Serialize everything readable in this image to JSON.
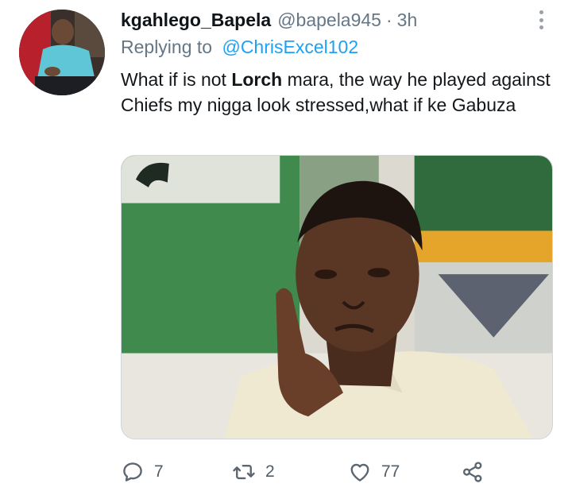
{
  "author": {
    "display_name": "kgahlego_Bapela",
    "handle": "@bapela945",
    "separator": "·",
    "time": "3h"
  },
  "reply": {
    "prefix": "Replying to",
    "mention": "@ChrisExcel102"
  },
  "tweet": {
    "text_before": "What if is not ",
    "text_bold": "Lorch",
    "text_after": " mara, the way he played against Chiefs my nigga look stressed,what if ke Gabuza"
  },
  "stats": {
    "replies": "7",
    "retweets": "2",
    "likes": "77"
  },
  "icons": {
    "more": "more-vertical-icon",
    "reply": "reply-icon",
    "retweet": "retweet-icon",
    "like": "heart-icon",
    "share": "share-icon"
  },
  "colors": {
    "text": "#0f1419",
    "secondary": "#657786",
    "link": "#1da1f2",
    "icon": "#5b6670"
  }
}
